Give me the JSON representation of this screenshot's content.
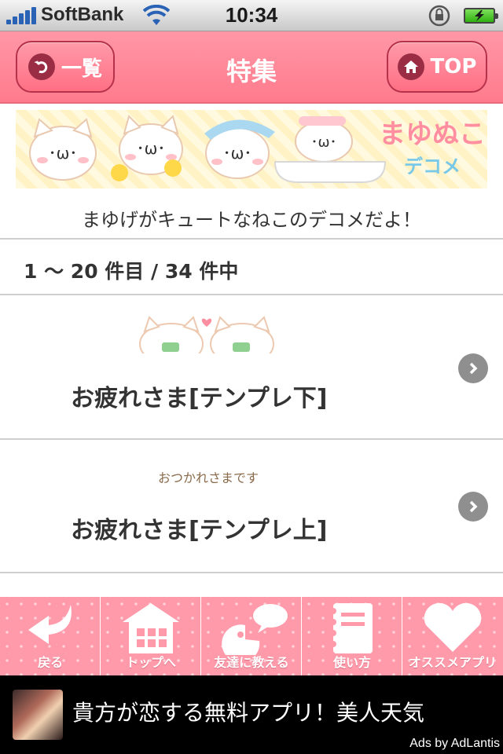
{
  "status_bar": {
    "carrier": "SoftBank",
    "time": "10:34"
  },
  "nav": {
    "back_label": "一覧",
    "title": "特集",
    "top_label": "TOP"
  },
  "banner": {
    "logo_text": "まゆぬこ",
    "logo_sub": "デコメ",
    "description": "まゆげがキュートなねこのデコメだよ！"
  },
  "results": {
    "count_text": "1 〜 20 件目 / 34 件中"
  },
  "items": [
    {
      "title": "お疲れさま[テンプレ下]",
      "thumb": "cat-pair-thumbnail"
    },
    {
      "title": "お疲れさま[テンプレ上]",
      "thumb_text": "おつかれさまです"
    }
  ],
  "tabbar": {
    "tabs": [
      {
        "label": "戻る",
        "icon": "back-arrow-icon"
      },
      {
        "label": "トップへ",
        "icon": "house-icon"
      },
      {
        "label": "友達に教える",
        "icon": "speech-bubble-icon"
      },
      {
        "label": "使い方",
        "icon": "notebook-icon"
      },
      {
        "label": "オススメアプリ",
        "icon": "heart-icon"
      }
    ]
  },
  "ad": {
    "text": "貴方が恋する無料アプリ！美人天気",
    "by": "Ads by AdLantis"
  },
  "colors": {
    "nav_pink": "#ff8a9b",
    "tab_pink": "#ff9aab",
    "ad_bg": "#000000"
  }
}
